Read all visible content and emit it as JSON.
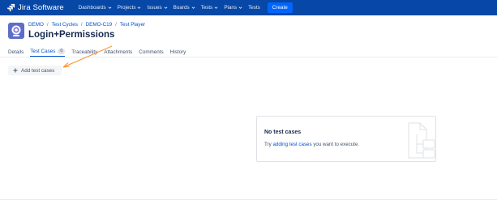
{
  "topbar": {
    "product_name": "Jira Software",
    "nav": [
      {
        "label": "Dashboards"
      },
      {
        "label": "Projects"
      },
      {
        "label": "Issues"
      },
      {
        "label": "Boards"
      },
      {
        "label": "Tests"
      },
      {
        "label": "Plans"
      },
      {
        "label": "Tests"
      }
    ],
    "create_label": "Create",
    "icons": [
      "jira-logo-icon",
      "chevron-down-icon"
    ]
  },
  "breadcrumb": [
    "DEMO",
    "Test Cycles",
    "DEMO-C19",
    "Test Player"
  ],
  "page": {
    "title": "Login+Permissions"
  },
  "tabs": [
    {
      "label": "Details"
    },
    {
      "label": "Test Cases",
      "badge": "0",
      "active": true
    },
    {
      "label": "Traceability"
    },
    {
      "label": "Attachments"
    },
    {
      "label": "Comments"
    },
    {
      "label": "History"
    }
  ],
  "actions": {
    "add_test_cases_label": "Add test cases"
  },
  "empty_state": {
    "title": "No test cases",
    "text_before": "Try ",
    "link_text": "adding test cases",
    "text_after": " you want to execute."
  },
  "colors": {
    "topbar": "#0747a6",
    "create_button": "#0065ff",
    "link": "#0052cc",
    "annotation_arrow": "#f79232"
  }
}
